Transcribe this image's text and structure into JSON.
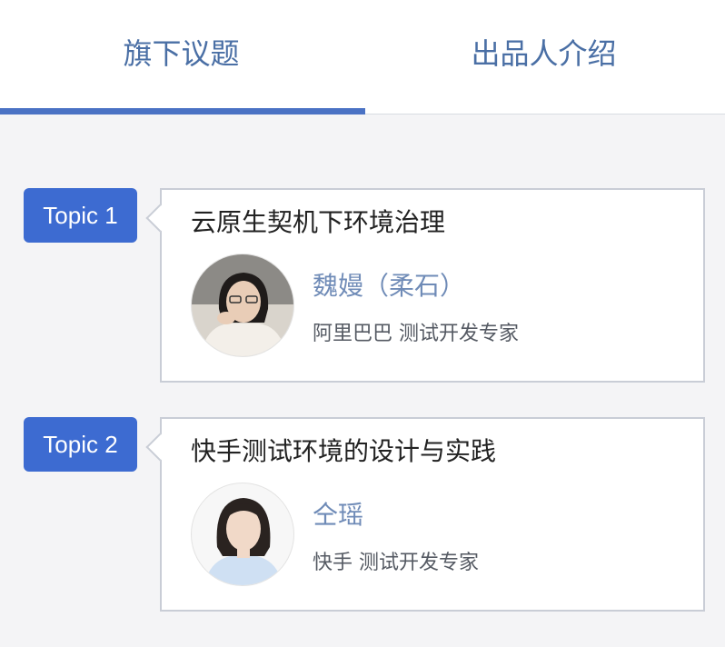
{
  "tabs": [
    {
      "label": "旗下议题",
      "active": true
    },
    {
      "label": "出品人介绍",
      "active": false
    }
  ],
  "topics": [
    {
      "badge": "Topic 1",
      "title": "云原生契机下环境治理",
      "speaker_name": "魏嫚（柔石）",
      "speaker_title": "阿里巴巴 测试开发专家",
      "avatar_icon": "speaker-photo-icon"
    },
    {
      "badge": "Topic 2",
      "title": "快手测试环境的设计与实践",
      "speaker_name": "仝瑶",
      "speaker_title": "快手 测试开发专家",
      "avatar_icon": "speaker-photo-icon"
    }
  ],
  "colors": {
    "accent": "#3d6bd1",
    "tab_text": "#4a6fa5",
    "speaker_name": "#6f8bb7",
    "background": "#f4f4f6"
  }
}
